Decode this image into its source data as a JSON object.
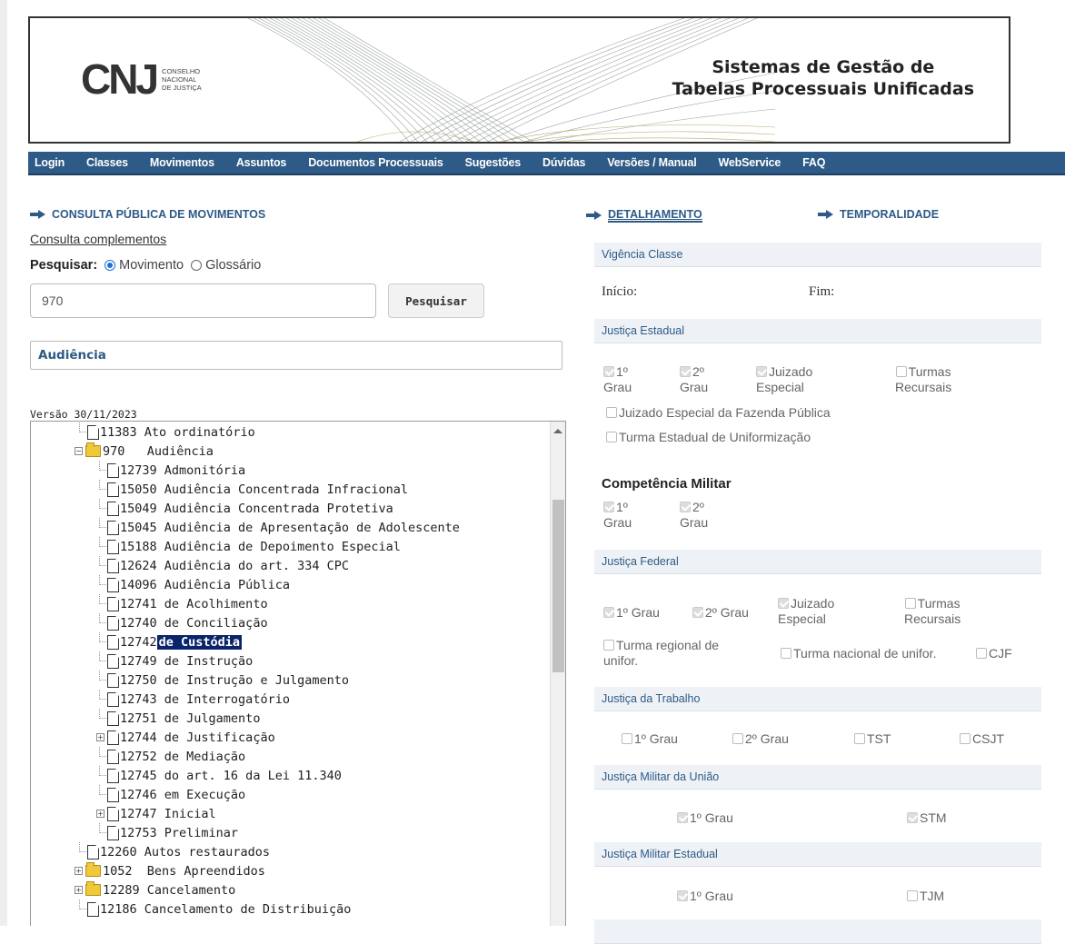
{
  "banner": {
    "logo_text": "CNJ",
    "logo_sub1": "CONSELHO",
    "logo_sub2": "NACIONAL",
    "logo_sub3": "DE JUSTIÇA",
    "title_line1": "Sistemas de Gestão de",
    "title_line2": "Tabelas Processuais Unificadas"
  },
  "nav": {
    "items": [
      "Login",
      "Classes",
      "Movimentos",
      "Assuntos",
      "Documentos Processuais",
      "Sugestões",
      "Dúvidas",
      "Versões / Manual",
      "WebService",
      "FAQ"
    ]
  },
  "left": {
    "heading": "CONSULTA PÚBLICA DE MOVIMENTOS",
    "complement_link": "Consulta complementos",
    "search_label": "Pesquisar:",
    "radio_movimento": "Movimento",
    "radio_glossario": "Glossário",
    "search_value": "970",
    "search_button": "Pesquisar",
    "result_title": "Audiência",
    "versao": "Versão 30/11/2023"
  },
  "tree": {
    "rows": [
      {
        "code": "11383",
        "label": "Ato ordinatório"
      },
      {
        "code": "970",
        "label": "Audiência"
      },
      {
        "code": "12739",
        "label": "Admonitória"
      },
      {
        "code": "15050",
        "label": "Audiência Concentrada Infracional"
      },
      {
        "code": "15049",
        "label": "Audiência Concentrada Protetiva"
      },
      {
        "code": "15045",
        "label": "Audiência de Apresentação de Adolescente"
      },
      {
        "code": "15188",
        "label": "Audiência de Depoimento Especial"
      },
      {
        "code": "12624",
        "label": "Audiência do art. 334 CPC"
      },
      {
        "code": "14096",
        "label": "Audiência Pública"
      },
      {
        "code": "12741",
        "label": "de Acolhimento"
      },
      {
        "code": "12740",
        "label": "de Conciliação"
      },
      {
        "code": "12742",
        "label": "de Custódia"
      },
      {
        "code": "12749",
        "label": "de Instrução"
      },
      {
        "code": "12750",
        "label": "de Instrução e Julgamento"
      },
      {
        "code": "12743",
        "label": "de Interrogatório"
      },
      {
        "code": "12751",
        "label": "de Julgamento"
      },
      {
        "code": "12744",
        "label": "de Justificação"
      },
      {
        "code": "12752",
        "label": "de Mediação"
      },
      {
        "code": "12745",
        "label": "do art. 16 da Lei 11.340"
      },
      {
        "code": "12746",
        "label": "em Execução"
      },
      {
        "code": "12747",
        "label": "Inicial"
      },
      {
        "code": "12753",
        "label": "Preliminar"
      },
      {
        "code": "12260",
        "label": "Autos restaurados"
      },
      {
        "code": "1052",
        "label": "Bens Apreendidos"
      },
      {
        "code": "12289",
        "label": "Cancelamento"
      },
      {
        "code": "12186",
        "label": "Cancelamento de Distribuição"
      }
    ]
  },
  "right": {
    "tab_detalhamento": "DETALHAMENTO",
    "tab_temporalidade": "TEMPORALIDADE",
    "vigencia": "Vigência Classe",
    "inicio": "Início:",
    "fim": "Fim:",
    "just_estadual": "Justiça Estadual",
    "est_1": "1º",
    "est_1b": "Grau",
    "est_2": "2º",
    "est_2b": "Grau",
    "est_je": "Juizado",
    "est_jeb": "Especial",
    "est_tr": "Turmas",
    "est_trb": "Recursais",
    "est_jefp": "Juizado Especial da Fazenda Pública",
    "est_teu": "Turma Estadual de Uniformização",
    "comp_militar": "Competência Militar",
    "cm_1": "1º",
    "cm_1b": "Grau",
    "cm_2": "2º",
    "cm_2b": "Grau",
    "just_federal": "Justiça Federal",
    "fed_1": "1º Grau",
    "fed_2": "2º Grau",
    "fed_je": "Juizado",
    "fed_jeb": "Especial",
    "fed_tr": "Turmas",
    "fed_trb": "Recursais",
    "fed_trun": "Turma regional de",
    "fed_trunb": "unifor.",
    "fed_tnu": "Turma nacional de unifor.",
    "fed_cjf": "CJF",
    "just_trabalho": "Justiça da Trabalho",
    "trab_1": "1º Grau",
    "trab_2": "2º Grau",
    "trab_tst": "TST",
    "trab_csjt": "CSJT",
    "just_mil_uniao": "Justiça Militar da União",
    "mu_1": "1º Grau",
    "mu_stm": "STM",
    "just_mil_est": "Justiça Militar Estadual",
    "me_1": "1º Grau",
    "me_tjm": "TJM"
  }
}
